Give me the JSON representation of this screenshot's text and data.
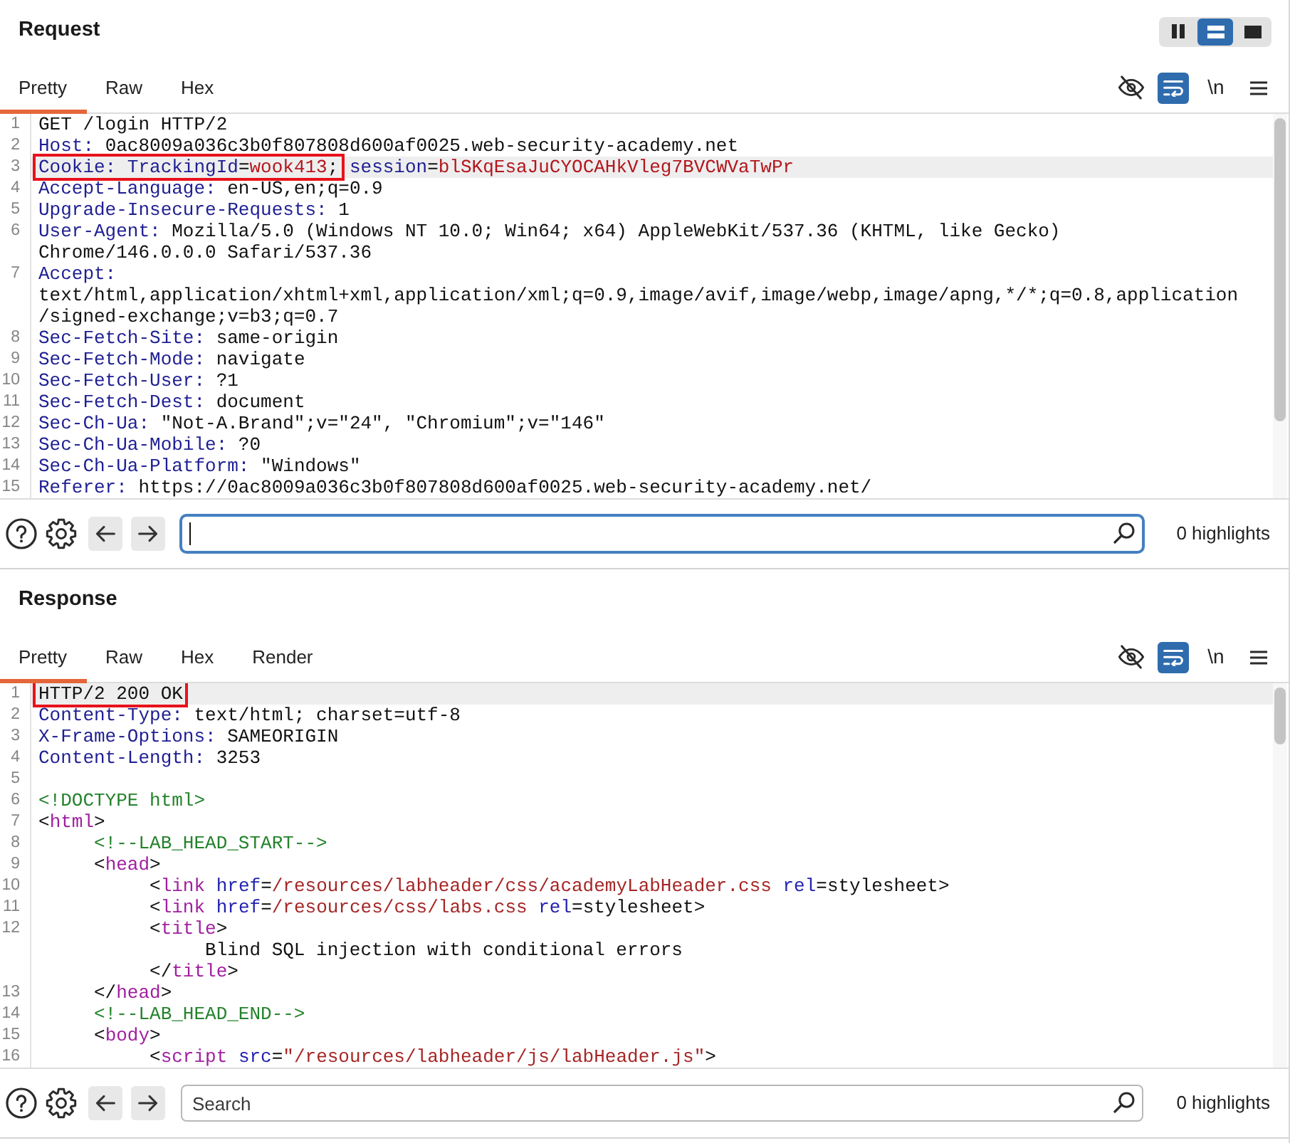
{
  "panels": [
    {
      "title": "Request",
      "layout_buttons": [
        {
          "kind": "side-by-side",
          "selected": false
        },
        {
          "kind": "stacked",
          "selected": true
        },
        {
          "kind": "single",
          "selected": false
        }
      ],
      "tabs": [
        {
          "label": "Pretty",
          "selected": true
        },
        {
          "label": "Raw",
          "selected": false
        },
        {
          "label": "Hex",
          "selected": false
        }
      ],
      "view_options": [
        {
          "kind": "hide",
          "on": false
        },
        {
          "kind": "wrap",
          "on": true
        },
        {
          "kind": "newline",
          "label": "\\n",
          "on": false
        },
        {
          "kind": "menu"
        }
      ],
      "lines": [
        {
          "number": "1",
          "highlighted": false,
          "display_rows": [
            {
              "tokens": [
                {
                  "kind": "text",
                  "text": "GET /login HTTP/2"
                }
              ]
            }
          ]
        },
        {
          "number": "2",
          "highlighted": false,
          "display_rows": [
            {
              "tokens": [
                {
                  "kind": "key",
                  "text": "Host:"
                },
                {
                  "kind": "text",
                  "text": " 0ac8009a036c3b0f807808d600af0025.web-security-academy.net"
                }
              ]
            }
          ]
        },
        {
          "number": "3",
          "highlighted": true,
          "display_rows": [
            {
              "tokens": [
                {
                  "kind": "annotation",
                  "tokens": [
                    {
                      "kind": "key",
                      "text": "Cookie: TrackingId"
                    },
                    {
                      "kind": "text",
                      "text": "="
                    },
                    {
                      "kind": "value",
                      "text": "wook413"
                    },
                    {
                      "kind": "text",
                      "text": ";"
                    }
                  ]
                },
                {
                  "kind": "key",
                  "text": " session"
                },
                {
                  "kind": "text",
                  "text": "="
                },
                {
                  "kind": "value",
                  "text": "blSKqEsaJuCYOCAHkVleg7BVCWVaTwPr"
                }
              ]
            }
          ]
        },
        {
          "number": "4",
          "highlighted": false,
          "display_rows": [
            {
              "tokens": [
                {
                  "kind": "key",
                  "text": "Accept-Language:"
                },
                {
                  "kind": "text",
                  "text": " en-US,en;q=0.9"
                }
              ]
            }
          ]
        },
        {
          "number": "5",
          "highlighted": false,
          "display_rows": [
            {
              "tokens": [
                {
                  "kind": "key",
                  "text": "Upgrade-Insecure-Requests:"
                },
                {
                  "kind": "text",
                  "text": " 1"
                }
              ]
            }
          ]
        },
        {
          "number": "6",
          "highlighted": false,
          "display_rows": [
            {
              "tokens": [
                {
                  "kind": "key",
                  "text": "User-Agent:"
                },
                {
                  "kind": "text",
                  "text": " Mozilla/5.0 (Windows NT 10.0; Win64; x64) AppleWebKit/537.36 (KHTML, like Gecko)"
                }
              ]
            },
            {
              "tokens": [
                {
                  "kind": "text",
                  "text": "Chrome/146.0.0.0 Safari/537.36"
                }
              ]
            }
          ]
        },
        {
          "number": "7",
          "highlighted": false,
          "display_rows": [
            {
              "tokens": [
                {
                  "kind": "key",
                  "text": "Accept:"
                }
              ]
            },
            {
              "tokens": [
                {
                  "kind": "text",
                  "text": "text/html,application/xhtml+xml,application/xml;q=0.9,image/avif,image/webp,image/apng,*/*;q=0.8,application"
                }
              ]
            },
            {
              "tokens": [
                {
                  "kind": "text",
                  "text": "/signed-exchange;v=b3;q=0.7"
                }
              ]
            }
          ]
        },
        {
          "number": "8",
          "highlighted": false,
          "display_rows": [
            {
              "tokens": [
                {
                  "kind": "key",
                  "text": "Sec-Fetch-Site:"
                },
                {
                  "kind": "text",
                  "text": " same-origin"
                }
              ]
            }
          ]
        },
        {
          "number": "9",
          "highlighted": false,
          "display_rows": [
            {
              "tokens": [
                {
                  "kind": "key",
                  "text": "Sec-Fetch-Mode:"
                },
                {
                  "kind": "text",
                  "text": " navigate"
                }
              ]
            }
          ]
        },
        {
          "number": "10",
          "highlighted": false,
          "display_rows": [
            {
              "tokens": [
                {
                  "kind": "key",
                  "text": "Sec-Fetch-User:"
                },
                {
                  "kind": "text",
                  "text": " ?1"
                }
              ]
            }
          ]
        },
        {
          "number": "11",
          "highlighted": false,
          "display_rows": [
            {
              "tokens": [
                {
                  "kind": "key",
                  "text": "Sec-Fetch-Dest:"
                },
                {
                  "kind": "text",
                  "text": " document"
                }
              ]
            }
          ]
        },
        {
          "number": "12",
          "highlighted": false,
          "display_rows": [
            {
              "tokens": [
                {
                  "kind": "key",
                  "text": "Sec-Ch-Ua:"
                },
                {
                  "kind": "text",
                  "text": " \"Not-A.Brand\";v=\"24\", \"Chromium\";v=\"146\""
                }
              ]
            }
          ]
        },
        {
          "number": "13",
          "highlighted": false,
          "display_rows": [
            {
              "tokens": [
                {
                  "kind": "key",
                  "text": "Sec-Ch-Ua-Mobile:"
                },
                {
                  "kind": "text",
                  "text": " ?0"
                }
              ]
            }
          ]
        },
        {
          "number": "14",
          "highlighted": false,
          "display_rows": [
            {
              "tokens": [
                {
                  "kind": "key",
                  "text": "Sec-Ch-Ua-Platform:"
                },
                {
                  "kind": "text",
                  "text": " \"Windows\""
                }
              ]
            }
          ]
        },
        {
          "number": "15",
          "highlighted": false,
          "display_rows": [
            {
              "tokens": [
                {
                  "kind": "key",
                  "text": "Referer:"
                },
                {
                  "kind": "text",
                  "text": " https://0ac8009a036c3b0f807808d600af0025.web-security-academy.net/"
                }
              ]
            }
          ]
        }
      ],
      "search": {
        "focused": true,
        "highlights": "0 highlights"
      }
    },
    {
      "title": "Response",
      "tabs": [
        {
          "label": "Pretty",
          "selected": true
        },
        {
          "label": "Raw",
          "selected": false
        },
        {
          "label": "Hex",
          "selected": false
        },
        {
          "label": "Render",
          "selected": false
        }
      ],
      "view_options": [
        {
          "kind": "hide",
          "on": false
        },
        {
          "kind": "wrap",
          "on": true
        },
        {
          "kind": "newline",
          "label": "\\n",
          "on": false
        },
        {
          "kind": "menu"
        }
      ],
      "lines": [
        {
          "number": "1",
          "highlighted": true,
          "display_rows": [
            {
              "tokens": [
                {
                  "kind": "annotation",
                  "tokens": [
                    {
                      "kind": "text",
                      "text": "HTTP/2 200 OK"
                    }
                  ]
                }
              ]
            }
          ]
        },
        {
          "number": "2",
          "highlighted": false,
          "display_rows": [
            {
              "tokens": [
                {
                  "kind": "key",
                  "text": "Content-Type:"
                },
                {
                  "kind": "text",
                  "text": " text/html; charset=utf-8"
                }
              ]
            }
          ]
        },
        {
          "number": "3",
          "highlighted": false,
          "display_rows": [
            {
              "tokens": [
                {
                  "kind": "key",
                  "text": "X-Frame-Options:"
                },
                {
                  "kind": "text",
                  "text": " SAMEORIGIN"
                }
              ]
            }
          ]
        },
        {
          "number": "4",
          "highlighted": false,
          "display_rows": [
            {
              "tokens": [
                {
                  "kind": "key",
                  "text": "Content-Length:"
                },
                {
                  "kind": "text",
                  "text": " 3253"
                }
              ]
            }
          ]
        },
        {
          "number": "5",
          "highlighted": false
        },
        {
          "number": "6",
          "highlighted": false,
          "display_rows": [
            {
              "tokens": [
                {
                  "kind": "comment",
                  "text": "<!DOCTYPE html>"
                }
              ]
            }
          ]
        },
        {
          "number": "7",
          "highlighted": false,
          "display_rows": [
            {
              "tokens": [
                {
                  "kind": "text",
                  "text": "<"
                },
                {
                  "kind": "tag",
                  "text": "html"
                },
                {
                  "kind": "text",
                  "text": ">"
                }
              ]
            }
          ]
        },
        {
          "number": "8",
          "highlighted": false,
          "display_rows": [
            {
              "tokens": [
                {
                  "kind": "comment",
                  "text": "     <!--LAB_HEAD_START-->"
                }
              ]
            }
          ]
        },
        {
          "number": "9",
          "highlighted": false,
          "display_rows": [
            {
              "tokens": [
                {
                  "kind": "text",
                  "text": "     <"
                },
                {
                  "kind": "tag",
                  "text": "head"
                },
                {
                  "kind": "text",
                  "text": ">"
                }
              ]
            }
          ]
        },
        {
          "number": "10",
          "highlighted": false,
          "display_rows": [
            {
              "tokens": [
                {
                  "kind": "text",
                  "text": "          <"
                },
                {
                  "kind": "tag",
                  "text": "link"
                },
                {
                  "kind": "attr",
                  "text": " href"
                },
                {
                  "kind": "text",
                  "text": "="
                },
                {
                  "kind": "string",
                  "text": "/resources/labheader/css/academyLabHeader.css"
                },
                {
                  "kind": "attr",
                  "text": " rel"
                },
                {
                  "kind": "text",
                  "text": "=stylesheet>"
                }
              ]
            }
          ]
        },
        {
          "number": "11",
          "highlighted": false,
          "display_rows": [
            {
              "tokens": [
                {
                  "kind": "text",
                  "text": "          <"
                },
                {
                  "kind": "tag",
                  "text": "link"
                },
                {
                  "kind": "attr",
                  "text": " href"
                },
                {
                  "kind": "text",
                  "text": "="
                },
                {
                  "kind": "string",
                  "text": "/resources/css/labs.css"
                },
                {
                  "kind": "attr",
                  "text": " rel"
                },
                {
                  "kind": "text",
                  "text": "=stylesheet>"
                }
              ]
            }
          ]
        },
        {
          "number": "12",
          "highlighted": false,
          "display_rows": [
            {
              "tokens": [
                {
                  "kind": "text",
                  "text": "          <"
                },
                {
                  "kind": "tag",
                  "text": "title"
                },
                {
                  "kind": "text",
                  "text": ">"
                }
              ]
            },
            {
              "tokens": [
                {
                  "kind": "text",
                  "text": "               Blind SQL injection with conditional errors"
                }
              ]
            },
            {
              "tokens": [
                {
                  "kind": "text",
                  "text": "          </"
                },
                {
                  "kind": "tag",
                  "text": "title"
                },
                {
                  "kind": "text",
                  "text": ">"
                }
              ]
            }
          ]
        },
        {
          "number": "13",
          "highlighted": false,
          "display_rows": [
            {
              "tokens": [
                {
                  "kind": "text",
                  "text": "     </"
                },
                {
                  "kind": "tag",
                  "text": "head"
                },
                {
                  "kind": "text",
                  "text": ">"
                }
              ]
            }
          ]
        },
        {
          "number": "14",
          "highlighted": false,
          "display_rows": [
            {
              "tokens": [
                {
                  "kind": "comment",
                  "text": "     <!--LAB_HEAD_END-->"
                }
              ]
            }
          ]
        },
        {
          "number": "15",
          "highlighted": false,
          "display_rows": [
            {
              "tokens": [
                {
                  "kind": "text",
                  "text": "     <"
                },
                {
                  "kind": "tag",
                  "text": "body"
                },
                {
                  "kind": "text",
                  "text": ">"
                }
              ]
            }
          ]
        },
        {
          "number": "16",
          "highlighted": false,
          "display_rows": [
            {
              "tokens": [
                {
                  "kind": "text",
                  "text": "          <"
                },
                {
                  "kind": "tag",
                  "text": "script"
                },
                {
                  "kind": "attr",
                  "text": " src"
                },
                {
                  "kind": "text",
                  "text": "="
                },
                {
                  "kind": "string",
                  "text": "\"/resources/labheader/js/labHeader.js\""
                },
                {
                  "kind": "text",
                  "text": ">"
                }
              ]
            }
          ]
        }
      ],
      "search": {
        "placeholder": "Search",
        "focused": false,
        "highlights": "0 highlights"
      }
    }
  ]
}
